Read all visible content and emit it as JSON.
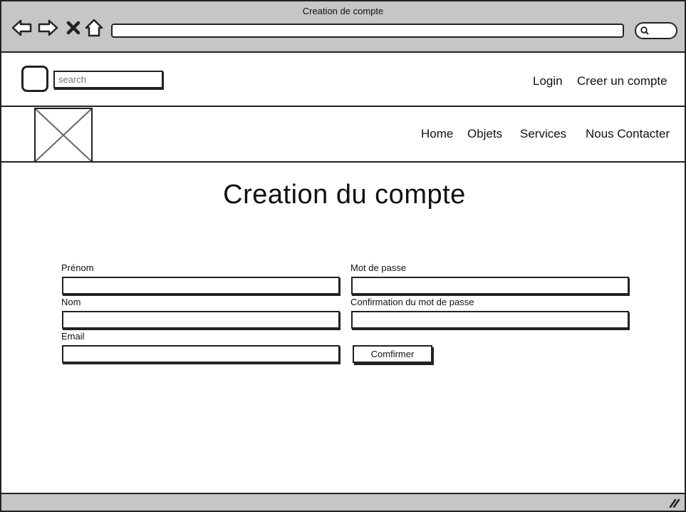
{
  "window": {
    "title": "Creation de compte"
  },
  "browser": {
    "icons": [
      "back-arrow-icon",
      "forward-arrow-icon",
      "close-x-icon",
      "home-icon"
    ],
    "url": "",
    "search_icon": "magnifier-icon"
  },
  "header": {
    "search_placeholder": "search",
    "login": "Login",
    "create_account": "Creer un compte"
  },
  "nav": {
    "items": [
      "Home",
      "Objets",
      "Services",
      "Nous Contacter"
    ]
  },
  "main": {
    "title": "Creation du compte",
    "form": {
      "prenom_label": "Prénom",
      "nom_label": "Nom",
      "email_label": "Email",
      "password_label": "Mot de passe",
      "confirm_password_label": "Confirmation du mot de passe",
      "submit_label": "Comfirmer"
    }
  }
}
